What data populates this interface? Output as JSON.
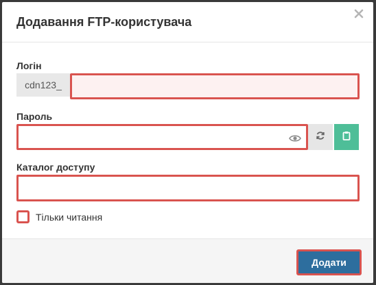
{
  "dialog": {
    "title": "Додавання FTP-користувача",
    "close_icon": "close-icon"
  },
  "login": {
    "label": "Логін",
    "prefix": "cdn123_",
    "value": "",
    "placeholder": ""
  },
  "password": {
    "label": "Пароль",
    "value": "",
    "placeholder": "",
    "toggle_icon": "eye-icon",
    "generate_icon": "refresh-icon",
    "copy_icon": "clipboard-icon"
  },
  "directory": {
    "label": "Каталог доступу",
    "value": "",
    "placeholder": ""
  },
  "readonly": {
    "label": "Тільки читання",
    "checked": false
  },
  "footer": {
    "submit_label": "Додати"
  },
  "colors": {
    "accent": "#2d6e9e",
    "error_border": "#d9534f",
    "copy_button": "#4ebe98"
  }
}
